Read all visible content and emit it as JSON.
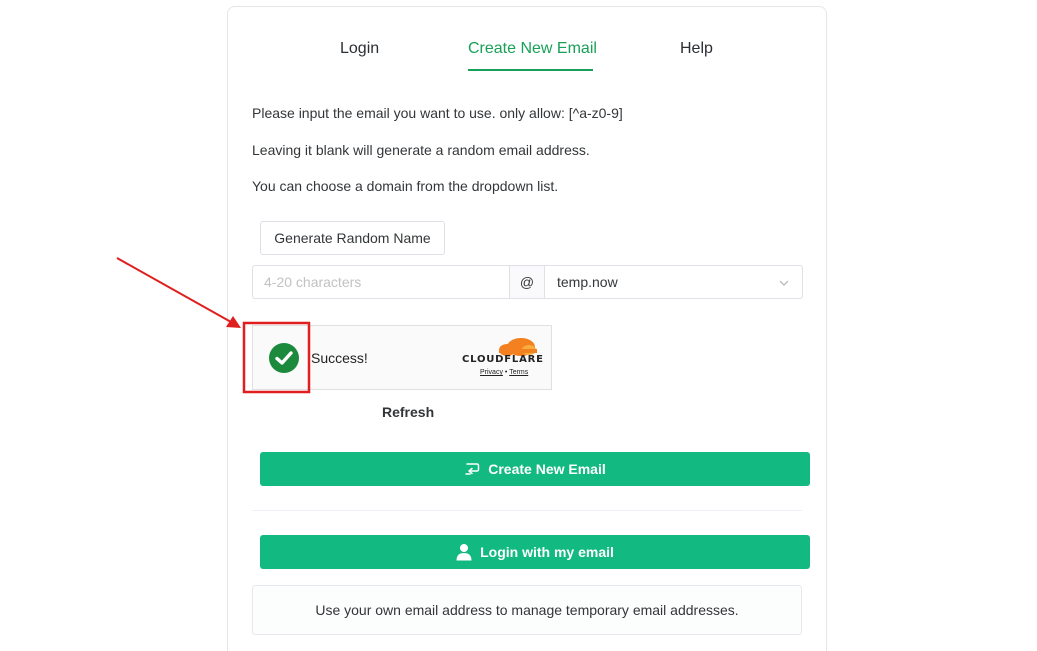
{
  "tabs": [
    {
      "label": "Login",
      "active": false
    },
    {
      "label": "Create New Email",
      "active": true
    },
    {
      "label": "Help",
      "active": false
    }
  ],
  "descriptions": [
    "Please input the email you want to use. only allow: [^a-z0-9]",
    "Leaving it blank will generate a random email address.",
    "You can choose a domain from the dropdown list."
  ],
  "generate_button": {
    "label": "Generate Random Name"
  },
  "email_form": {
    "name_placeholder": "4-20 characters",
    "name_value": "",
    "at_sign": "@",
    "domain_selected": "temp.now"
  },
  "captcha": {
    "status_text": "Success!",
    "brand": "CLOUDFLARE",
    "privacy_label": "Privacy",
    "separator": "•",
    "terms_label": "Terms",
    "refresh_label": "Refresh"
  },
  "create_button": {
    "label": "Create New Email",
    "icon": "create-email-icon"
  },
  "login_button": {
    "label": "Login with my email",
    "icon": "user-icon"
  },
  "info_text": "Use your own email address to manage temporary email addresses.",
  "colors": {
    "accent": "#18a058",
    "button_green": "#12b981",
    "annotation_red": "#e01e1e",
    "cloudflare_orange": "#f48120",
    "success_green": "#1b8a3c"
  }
}
